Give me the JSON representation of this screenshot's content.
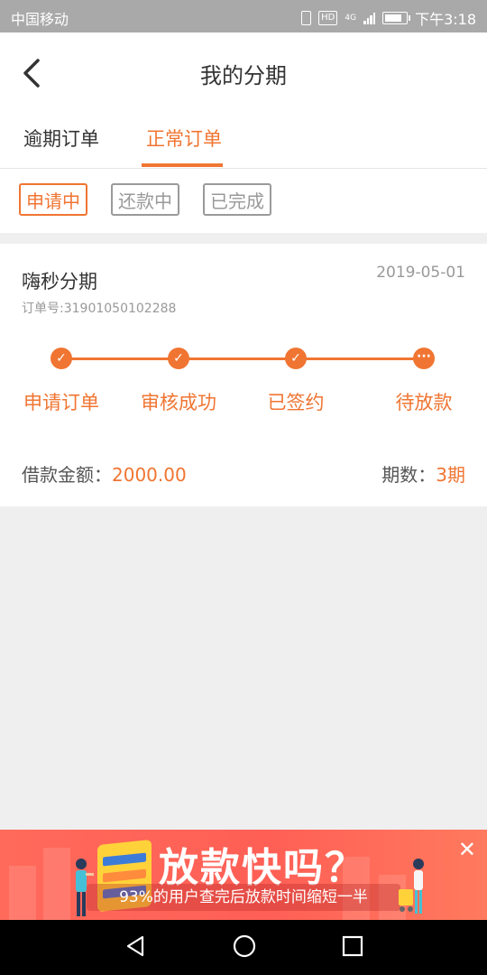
{
  "status_bar": {
    "carrier": "中国移动",
    "network_badge": "HD",
    "network_type": "4G",
    "time": "下午3:18",
    "icons": [
      "vibrate-icon",
      "hd-icon",
      "signal-icon",
      "battery-icon"
    ]
  },
  "header": {
    "title": "我的分期",
    "back_icon": "chevron-left-icon"
  },
  "tabs": [
    {
      "label": "逾期订单",
      "active": false
    },
    {
      "label": "正常订单",
      "active": true
    }
  ],
  "filters": [
    {
      "label": "申请中",
      "active": true
    },
    {
      "label": "还款中",
      "active": false
    },
    {
      "label": "已完成",
      "active": false
    }
  ],
  "order": {
    "name": "嗨秒分期",
    "date": "2019-05-01",
    "order_no": "订单号:31901050102288",
    "steps": [
      {
        "label": "申请订单",
        "status": "done",
        "icon": "check-icon"
      },
      {
        "label": "审核成功",
        "status": "done",
        "icon": "check-icon"
      },
      {
        "label": "已签约",
        "status": "done",
        "icon": "check-icon"
      },
      {
        "label": "待放款",
        "status": "pending",
        "icon": "more-icon"
      }
    ],
    "amount_label": "借款金额：",
    "amount_value": "2000.00",
    "period_label": "期数：",
    "period_value": "3期"
  },
  "banner": {
    "headline": "放款快吗？",
    "subtitle": "93%的用户查完后放款时间缩短一半",
    "close_icon": "close-icon"
  },
  "nav_bar": {
    "buttons": [
      "back-triangle-icon",
      "home-circle-icon",
      "recent-square-icon"
    ]
  },
  "colors": {
    "accent": "#f07532",
    "background": "#efefef",
    "banner": "#ff5f55",
    "status_bar": "#a9a9a9"
  }
}
